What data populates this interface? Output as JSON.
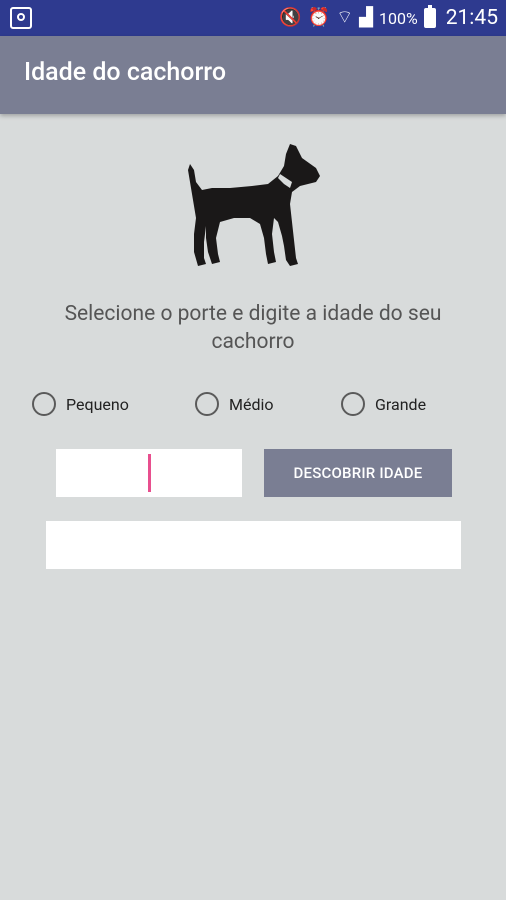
{
  "status_bar": {
    "battery_percent": "100%",
    "time": "21:45",
    "icons": [
      "notification-icon",
      "mute-icon",
      "alarm-icon",
      "wifi-icon",
      "signal-icon",
      "battery-icon"
    ]
  },
  "app_bar": {
    "title": "Idade do cachorro"
  },
  "image": {
    "icon": "dog-icon"
  },
  "prompt": "Selecione o porte e digite a idade do seu cachorro",
  "size_options": [
    {
      "label": "Pequeno",
      "selected": false
    },
    {
      "label": "Médio",
      "selected": false
    },
    {
      "label": "Grande",
      "selected": false
    }
  ],
  "age_input": {
    "value": ""
  },
  "discover_button": {
    "label": "DESCOBRIR IDADE"
  },
  "result": {
    "value": ""
  },
  "colors": {
    "status_bar": "#2e3a8f",
    "app_bar": "#7a7e93",
    "background": "#d8dbdb",
    "cursor": "#e84f8e"
  }
}
